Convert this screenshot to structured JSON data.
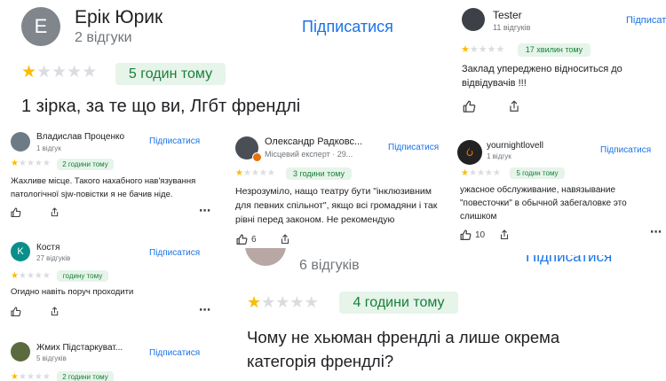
{
  "colors": {
    "star_on": "#fbbc04",
    "star_off": "#dadce0",
    "badge_bg": "#e6f4ea",
    "badge_text": "#188038",
    "link": "#1a73e8"
  },
  "review_erik": {
    "avatar_letter": "E",
    "name": "Ерік Юрик",
    "count": "2 відгуки",
    "follow": "Підписатися",
    "rating": 1,
    "time": "5 годин тому",
    "text": "1 зірка, за те що ви, Лгбт френдлі"
  },
  "review_tester": {
    "name": "Tester",
    "count": "11 відгуків",
    "follow": "Підписатися",
    "rating": 1,
    "time": "17 хвилин тому",
    "text": "Заклад упереджено відноситься до відвідувачів !!!"
  },
  "review_protsenko": {
    "name": "Владислав Проценко",
    "count": "1 відгук",
    "follow": "Підписатися",
    "rating": 1,
    "time": "2 години тому",
    "text": "Жахливе місце. Такого нахабного нав'язування патологічної sjw-повістки я не бачив ніде.",
    "more": "⋯"
  },
  "review_radkov": {
    "name": "Олександр Радковс...",
    "count": "Місцевий експерт · 29...",
    "follow": "Підписатися",
    "rating": 1,
    "time": "3 години тому",
    "text": "Незрозуміло, нащо театру бути \"інклюзивним для певних спільнот\", якщо всі громадяни і так рівні перед законом. Не рекомендую",
    "likes": "6"
  },
  "review_yournight": {
    "name": "yournightlovell",
    "count": "1 відгук",
    "follow": "Підписатися",
    "rating": 1,
    "time": "5 годин тому",
    "text": "ужасное обслуживание, навязывание \"повесточки\" в обычной забегаловке это слишком",
    "likes": "10",
    "more": "⋯"
  },
  "review_kostia": {
    "avatar_letter": "K",
    "name": "Костя",
    "count": "27 відгуків",
    "follow": "Підписатися",
    "rating": 1,
    "time": "годину тому",
    "text": "Огидно навіть поруч проходити",
    "more": "⋯"
  },
  "review_zhmykh": {
    "name": "Жмих Підстаркуват...",
    "count": "5 відгуків",
    "follow": "Підписатися",
    "rating": 1,
    "time": "2 години тому"
  },
  "review_bottom": {
    "count": "6 відгуків",
    "follow": "Підписатися",
    "rating": 1,
    "time": "4 години тому",
    "text": "Чому не хьюман френдлі а лише окрема категорія френдлі?"
  }
}
